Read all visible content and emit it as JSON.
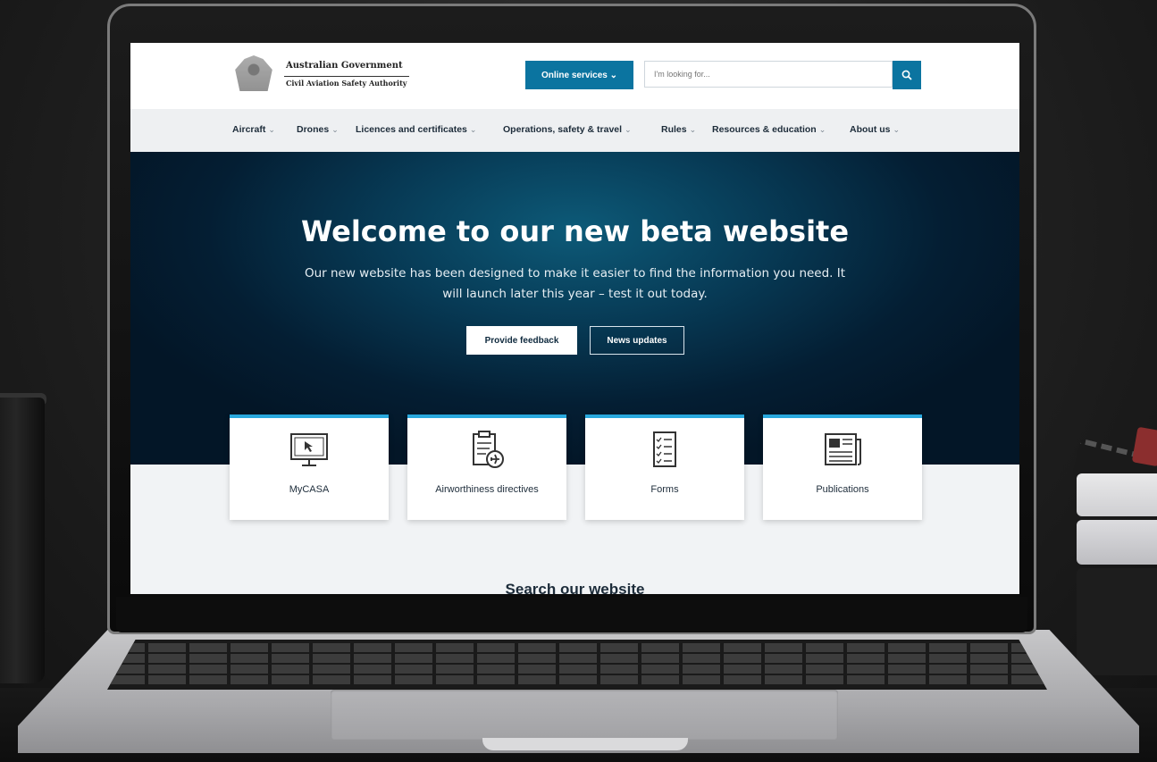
{
  "header": {
    "gov_line": "Australian Government",
    "agency_line": "Civil Aviation Safety Authority",
    "online_services_label": "Online services",
    "search_placeholder": "I'm looking for..."
  },
  "nav": {
    "items": [
      {
        "label": "Aircraft"
      },
      {
        "label": "Drones"
      },
      {
        "label": "Licences and certificates"
      },
      {
        "label": "Operations, safety & travel"
      },
      {
        "label": "Rules"
      },
      {
        "label": "Resources & education"
      },
      {
        "label": "About us"
      }
    ]
  },
  "hero": {
    "title": "Welcome to our new beta website",
    "subtitle": "Our new website has been designed to make it easier to find the information you need. It will launch later this year – test it out today.",
    "primary_button": "Provide feedback",
    "secondary_button": "News updates"
  },
  "cards": [
    {
      "label": "MyCASA",
      "icon": "monitor-cursor-icon"
    },
    {
      "label": "Airworthiness directives",
      "icon": "clipboard-plane-icon"
    },
    {
      "label": "Forms",
      "icon": "checklist-form-icon"
    },
    {
      "label": "Publications",
      "icon": "newspaper-icon"
    }
  ],
  "search_section": {
    "heading": "Search our website"
  },
  "colors": {
    "accent": "#0b74a0",
    "card_top_border": "#29a8dd",
    "hero_dark": "#031627",
    "nav_bg": "#eef0f2"
  }
}
